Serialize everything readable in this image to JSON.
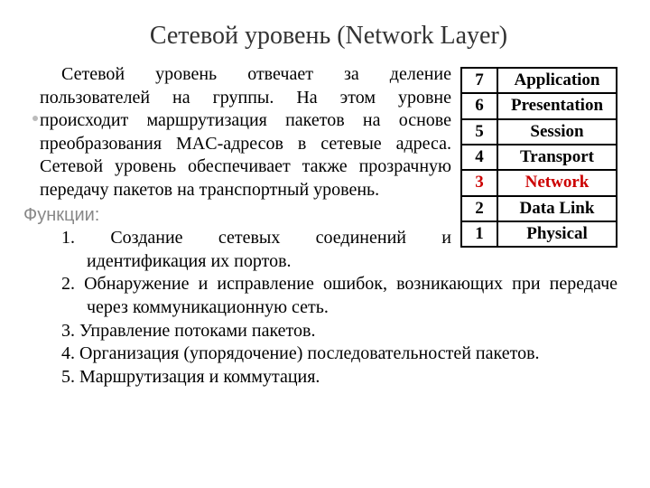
{
  "title": "Сетевой уровень (Network Layer)",
  "body_para": "Сетевой уровень отвечает за деление пользователей на группы. На этом уровне происходит маршрутизация пакетов на основе преобразования MAC-адресов в сетевые адреса. Сетевой уровень обеспечивает также прозрачную передачу пакетов на транспортный уровень.",
  "functions_label": "Функции:",
  "functions": [
    "Создание сетевых соединений и идентификация их портов.",
    "Обнаружение и исправление ошибок, возникающих при передаче через коммуникационную сеть.",
    "Управление потоками пакетов.",
    "Организация (упорядочение) последовательностей пакетов.",
    "Маршрутизация и коммутация."
  ],
  "osi": [
    {
      "n": "7",
      "name": "Application",
      "hl": false
    },
    {
      "n": "6",
      "name": "Presentation",
      "hl": false
    },
    {
      "n": "5",
      "name": "Session",
      "hl": false
    },
    {
      "n": "4",
      "name": "Transport",
      "hl": false
    },
    {
      "n": "3",
      "name": "Network",
      "hl": true
    },
    {
      "n": "2",
      "name": "Data Link",
      "hl": false
    },
    {
      "n": "1",
      "name": "Physical",
      "hl": false
    }
  ]
}
